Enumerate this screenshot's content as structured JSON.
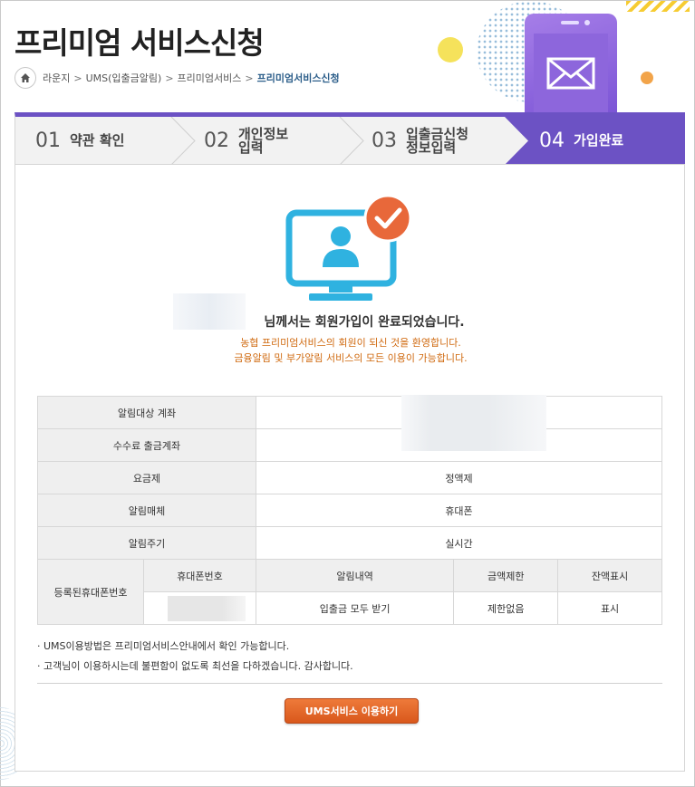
{
  "header": {
    "title": "프리미엄 서비스신청",
    "breadcrumb": [
      "라운지",
      "UMS(입출금알림)",
      "프리미엄서비스",
      "프리미엄서비스신청"
    ],
    "breadcrumb_sep": ">"
  },
  "steps": [
    {
      "num": "01",
      "label_line1": "약관 확인",
      "label_line2": ""
    },
    {
      "num": "02",
      "label_line1": "개인정보",
      "label_line2": "입력"
    },
    {
      "num": "03",
      "label_line1": "입출금신청",
      "label_line2": "정보입력"
    },
    {
      "num": "04",
      "label_line1": "가입완료",
      "label_line2": "",
      "active": true
    }
  ],
  "icons": {
    "home": "home-icon",
    "monitor": "monitor-user-icon",
    "check": "check-icon",
    "mail": "mail-icon"
  },
  "welcome": {
    "title": "님께서는 회원가입이 완료되었습니다.",
    "line1": "농협 프리미엄서비스의 회원이 되신 것을 환영합니다.",
    "line2": "금융알림 및 부가알림 서비스의 모든 이용이 가능합니다."
  },
  "info_table": {
    "rows": [
      {
        "label": "알림대상 계좌",
        "value": ""
      },
      {
        "label": "수수료 출금계좌",
        "value": ""
      },
      {
        "label": "요금제",
        "value": "정액제"
      },
      {
        "label": "알림매체",
        "value": "휴대폰"
      },
      {
        "label": "알림주기",
        "value": "실시간"
      }
    ],
    "phone_section_label": "등록된휴대폰번호",
    "phone_headers": [
      "휴대폰번호",
      "알림내역",
      "금액제한",
      "잔액표시"
    ],
    "phone_row": [
      "",
      "입출금 모두 받기",
      "제한없음",
      "표시"
    ]
  },
  "notes": [
    "· UMS이용방법은 프리미엄서비스안내에서 확인 가능합니다.",
    "· 고객님이 이용하시는데 불편함이 없도록 최선을 다하겠습니다. 감사합니다."
  ],
  "cta_label": "UMS서비스 이용하기",
  "colors": {
    "step_active": "#6c52c4",
    "accent_orange": "#d06a10",
    "monitor_blue": "#2fb2e0",
    "check_orange": "#e8683a"
  }
}
